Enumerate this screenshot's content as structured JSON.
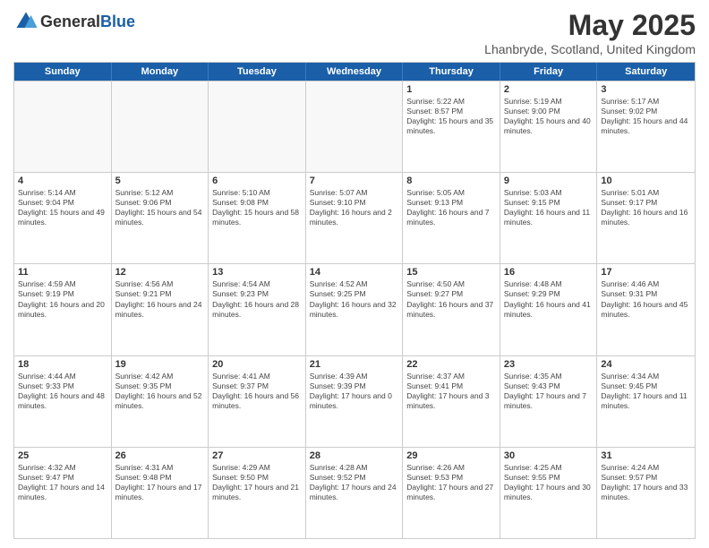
{
  "header": {
    "logo_general": "General",
    "logo_blue": "Blue",
    "month_title": "May 2025",
    "location": "Lhanbryde, Scotland, United Kingdom"
  },
  "weekdays": [
    "Sunday",
    "Monday",
    "Tuesday",
    "Wednesday",
    "Thursday",
    "Friday",
    "Saturday"
  ],
  "rows": [
    [
      {
        "day": "",
        "empty": true
      },
      {
        "day": "",
        "empty": true
      },
      {
        "day": "",
        "empty": true
      },
      {
        "day": "",
        "empty": true
      },
      {
        "day": "1",
        "sunrise": "Sunrise: 5:22 AM",
        "sunset": "Sunset: 8:57 PM",
        "daylight": "Daylight: 15 hours and 35 minutes."
      },
      {
        "day": "2",
        "sunrise": "Sunrise: 5:19 AM",
        "sunset": "Sunset: 9:00 PM",
        "daylight": "Daylight: 15 hours and 40 minutes."
      },
      {
        "day": "3",
        "sunrise": "Sunrise: 5:17 AM",
        "sunset": "Sunset: 9:02 PM",
        "daylight": "Daylight: 15 hours and 44 minutes."
      }
    ],
    [
      {
        "day": "4",
        "sunrise": "Sunrise: 5:14 AM",
        "sunset": "Sunset: 9:04 PM",
        "daylight": "Daylight: 15 hours and 49 minutes."
      },
      {
        "day": "5",
        "sunrise": "Sunrise: 5:12 AM",
        "sunset": "Sunset: 9:06 PM",
        "daylight": "Daylight: 15 hours and 54 minutes."
      },
      {
        "day": "6",
        "sunrise": "Sunrise: 5:10 AM",
        "sunset": "Sunset: 9:08 PM",
        "daylight": "Daylight: 15 hours and 58 minutes."
      },
      {
        "day": "7",
        "sunrise": "Sunrise: 5:07 AM",
        "sunset": "Sunset: 9:10 PM",
        "daylight": "Daylight: 16 hours and 2 minutes."
      },
      {
        "day": "8",
        "sunrise": "Sunrise: 5:05 AM",
        "sunset": "Sunset: 9:13 PM",
        "daylight": "Daylight: 16 hours and 7 minutes."
      },
      {
        "day": "9",
        "sunrise": "Sunrise: 5:03 AM",
        "sunset": "Sunset: 9:15 PM",
        "daylight": "Daylight: 16 hours and 11 minutes."
      },
      {
        "day": "10",
        "sunrise": "Sunrise: 5:01 AM",
        "sunset": "Sunset: 9:17 PM",
        "daylight": "Daylight: 16 hours and 16 minutes."
      }
    ],
    [
      {
        "day": "11",
        "sunrise": "Sunrise: 4:59 AM",
        "sunset": "Sunset: 9:19 PM",
        "daylight": "Daylight: 16 hours and 20 minutes."
      },
      {
        "day": "12",
        "sunrise": "Sunrise: 4:56 AM",
        "sunset": "Sunset: 9:21 PM",
        "daylight": "Daylight: 16 hours and 24 minutes."
      },
      {
        "day": "13",
        "sunrise": "Sunrise: 4:54 AM",
        "sunset": "Sunset: 9:23 PM",
        "daylight": "Daylight: 16 hours and 28 minutes."
      },
      {
        "day": "14",
        "sunrise": "Sunrise: 4:52 AM",
        "sunset": "Sunset: 9:25 PM",
        "daylight": "Daylight: 16 hours and 32 minutes."
      },
      {
        "day": "15",
        "sunrise": "Sunrise: 4:50 AM",
        "sunset": "Sunset: 9:27 PM",
        "daylight": "Daylight: 16 hours and 37 minutes."
      },
      {
        "day": "16",
        "sunrise": "Sunrise: 4:48 AM",
        "sunset": "Sunset: 9:29 PM",
        "daylight": "Daylight: 16 hours and 41 minutes."
      },
      {
        "day": "17",
        "sunrise": "Sunrise: 4:46 AM",
        "sunset": "Sunset: 9:31 PM",
        "daylight": "Daylight: 16 hours and 45 minutes."
      }
    ],
    [
      {
        "day": "18",
        "sunrise": "Sunrise: 4:44 AM",
        "sunset": "Sunset: 9:33 PM",
        "daylight": "Daylight: 16 hours and 48 minutes."
      },
      {
        "day": "19",
        "sunrise": "Sunrise: 4:42 AM",
        "sunset": "Sunset: 9:35 PM",
        "daylight": "Daylight: 16 hours and 52 minutes."
      },
      {
        "day": "20",
        "sunrise": "Sunrise: 4:41 AM",
        "sunset": "Sunset: 9:37 PM",
        "daylight": "Daylight: 16 hours and 56 minutes."
      },
      {
        "day": "21",
        "sunrise": "Sunrise: 4:39 AM",
        "sunset": "Sunset: 9:39 PM",
        "daylight": "Daylight: 17 hours and 0 minutes."
      },
      {
        "day": "22",
        "sunrise": "Sunrise: 4:37 AM",
        "sunset": "Sunset: 9:41 PM",
        "daylight": "Daylight: 17 hours and 3 minutes."
      },
      {
        "day": "23",
        "sunrise": "Sunrise: 4:35 AM",
        "sunset": "Sunset: 9:43 PM",
        "daylight": "Daylight: 17 hours and 7 minutes."
      },
      {
        "day": "24",
        "sunrise": "Sunrise: 4:34 AM",
        "sunset": "Sunset: 9:45 PM",
        "daylight": "Daylight: 17 hours and 11 minutes."
      }
    ],
    [
      {
        "day": "25",
        "sunrise": "Sunrise: 4:32 AM",
        "sunset": "Sunset: 9:47 PM",
        "daylight": "Daylight: 17 hours and 14 minutes."
      },
      {
        "day": "26",
        "sunrise": "Sunrise: 4:31 AM",
        "sunset": "Sunset: 9:48 PM",
        "daylight": "Daylight: 17 hours and 17 minutes."
      },
      {
        "day": "27",
        "sunrise": "Sunrise: 4:29 AM",
        "sunset": "Sunset: 9:50 PM",
        "daylight": "Daylight: 17 hours and 21 minutes."
      },
      {
        "day": "28",
        "sunrise": "Sunrise: 4:28 AM",
        "sunset": "Sunset: 9:52 PM",
        "daylight": "Daylight: 17 hours and 24 minutes."
      },
      {
        "day": "29",
        "sunrise": "Sunrise: 4:26 AM",
        "sunset": "Sunset: 9:53 PM",
        "daylight": "Daylight: 17 hours and 27 minutes."
      },
      {
        "day": "30",
        "sunrise": "Sunrise: 4:25 AM",
        "sunset": "Sunset: 9:55 PM",
        "daylight": "Daylight: 17 hours and 30 minutes."
      },
      {
        "day": "31",
        "sunrise": "Sunrise: 4:24 AM",
        "sunset": "Sunset: 9:57 PM",
        "daylight": "Daylight: 17 hours and 33 minutes."
      }
    ]
  ]
}
